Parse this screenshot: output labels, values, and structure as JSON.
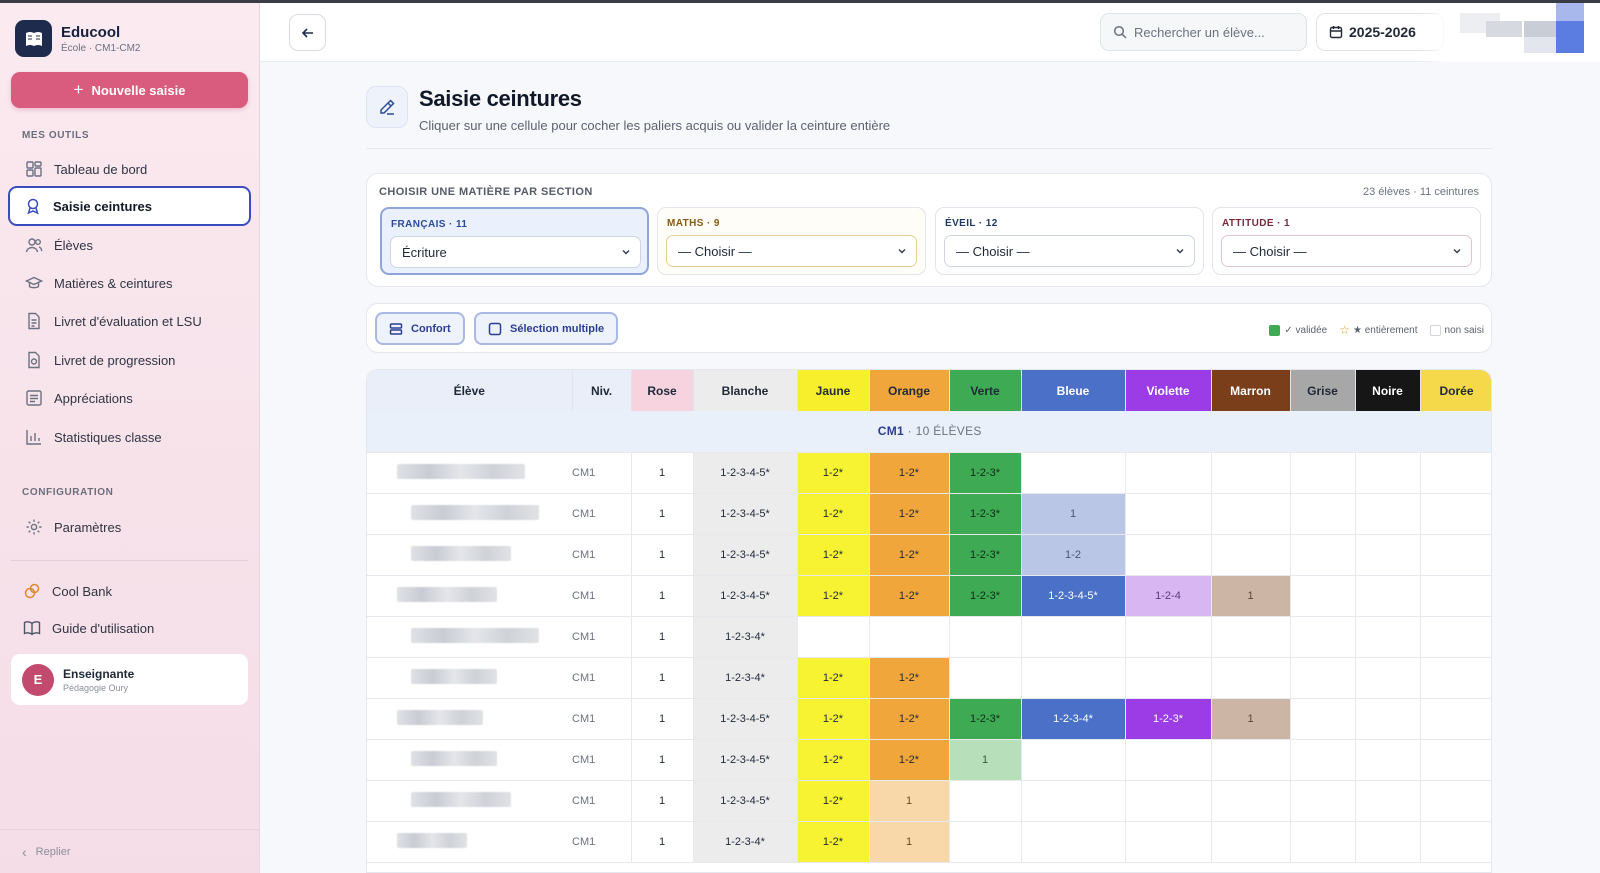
{
  "app": {
    "name": "Educool",
    "school": "École · CM1-CM2",
    "new_entry": "Nouvelle saisie"
  },
  "sidebar": {
    "section_tools": "MES OUTILS",
    "items": [
      {
        "label": "Tableau de bord",
        "icon": "dashboard-icon"
      },
      {
        "label": "Saisie ceintures",
        "icon": "award-icon",
        "active": true
      },
      {
        "label": "Élèves",
        "icon": "users-icon"
      },
      {
        "label": "Matières & ceintures",
        "icon": "graduation-cap-icon"
      },
      {
        "label": "Livret d'évaluation et LSU",
        "icon": "document-icon"
      },
      {
        "label": "Livret de progression",
        "icon": "progress-document-icon"
      },
      {
        "label": "Appréciations",
        "icon": "comment-icon"
      },
      {
        "label": "Statistiques classe",
        "icon": "bar-chart-icon"
      }
    ],
    "section_config": "CONFIGURATION",
    "settings": "Paramètres",
    "cool_bank": "Cool Bank",
    "guide": "Guide d'utilisation",
    "user": {
      "initial": "E",
      "name": "Enseignante",
      "sub": "Pédagogie Oury"
    },
    "collapse": "Replier"
  },
  "topbar": {
    "search_placeholder": "Rechercher un élève...",
    "year": "2025-2026"
  },
  "page": {
    "title": "Saisie ceintures",
    "subtitle": "Cliquer sur une cellule pour cocher les paliers acquis ou valider la ceinture entière"
  },
  "subjects": {
    "heading": "CHOISIR UNE MATIÈRE PAR SECTION",
    "count": "23 élèves · 11 ceintures",
    "items": [
      {
        "label": "FRANÇAIS · 11",
        "value": "Écriture",
        "color": "#2c4a9c"
      },
      {
        "label": "MATHS · 9",
        "value": "— Choisir —",
        "color": "#8a5a12"
      },
      {
        "label": "ÉVEIL · 12",
        "value": "— Choisir —",
        "color": "#1f3a66"
      },
      {
        "label": "ATTITUDE · 1",
        "value": "— Choisir —",
        "color": "#7a2b3b"
      }
    ]
  },
  "toolbar": {
    "comfort": "Confort",
    "multi": "Sélection multiple",
    "legend": {
      "validated": "✓ validée",
      "full": "★ entièrement",
      "none": "non saisi"
    }
  },
  "table": {
    "headers": [
      "Élève",
      "Niv.",
      "Rose",
      "Blanche",
      "Jaune",
      "Orange",
      "Verte",
      "Bleue",
      "Violette",
      "Marron",
      "Grise",
      "Noire",
      "Dorée"
    ],
    "header_colors": [
      "#e9eef8",
      "#e9eef8",
      "#f6d3df",
      "#ececec",
      "#f7ef2b",
      "#f0a63a",
      "#3eab54",
      "#4a70c8",
      "#9b3ce6",
      "#7a3e1a",
      "#a7a7a7",
      "#161616",
      "#f5d94a"
    ],
    "group": {
      "name": "CM1",
      "count": "· 10 ÉLÈVES"
    },
    "rows": [
      {
        "niv": "CM1",
        "cells": [
          "1",
          "1-2-3-4-5*",
          "1-2*",
          "1-2*",
          "1-2-3*",
          "",
          "",
          "",
          "",
          "",
          ""
        ]
      },
      {
        "niv": "CM1",
        "cells": [
          "1",
          "1-2-3-4-5*",
          "1-2*",
          "1-2*",
          "1-2-3*",
          "1",
          "",
          "",
          "",
          "",
          ""
        ]
      },
      {
        "niv": "CM1",
        "cells": [
          "1",
          "1-2-3-4-5*",
          "1-2*",
          "1-2*",
          "1-2-3*",
          "1-2",
          "",
          "",
          "",
          "",
          ""
        ]
      },
      {
        "niv": "CM1",
        "cells": [
          "1",
          "1-2-3-4-5*",
          "1-2*",
          "1-2*",
          "1-2-3*",
          "1-2-3-4-5*",
          "1-2-4",
          "1",
          "",
          "",
          ""
        ]
      },
      {
        "niv": "CM1",
        "cells": [
          "1",
          "1-2-3-4*",
          "",
          "",
          "",
          "",
          "",
          "",
          "",
          "",
          ""
        ]
      },
      {
        "niv": "CM1",
        "cells": [
          "1",
          "1-2-3-4*",
          "1-2*",
          "1-2*",
          "",
          "",
          "",
          "",
          "",
          "",
          ""
        ]
      },
      {
        "niv": "CM1",
        "cells": [
          "1",
          "1-2-3-4-5*",
          "1-2*",
          "1-2*",
          "1-2-3*",
          "1-2-3-4*",
          "1-2-3*",
          "1",
          "",
          "",
          ""
        ]
      },
      {
        "niv": "CM1",
        "cells": [
          "1",
          "1-2-3-4-5*",
          "1-2*",
          "1-2*",
          "1",
          "",
          "",
          "",
          "",
          "",
          ""
        ]
      },
      {
        "niv": "CM1",
        "cells": [
          "1",
          "1-2-3-4-5*",
          "1-2*",
          "1",
          "",
          "",
          "",
          "",
          "",
          "",
          ""
        ]
      },
      {
        "niv": "CM1",
        "cells": [
          "1",
          "1-2-3-4*",
          "1-2*",
          "1",
          "",
          "",
          "",
          "",
          "",
          "",
          ""
        ]
      }
    ]
  }
}
